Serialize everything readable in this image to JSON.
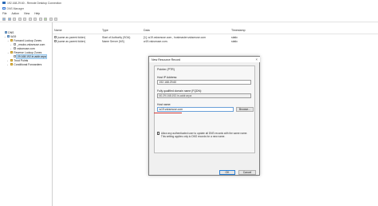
{
  "rdp": {
    "title": "192.168.29.60 - Remote Desktop Connection"
  },
  "app": {
    "title": "DNS Manager"
  },
  "menu": [
    "File",
    "Action",
    "View",
    "Help"
  ],
  "tree": [
    {
      "label": "DNS",
      "icon": "dns-icon",
      "arrow": "",
      "indent": 0
    },
    {
      "label": "W19",
      "icon": "server-icon",
      "arrow": "⌄",
      "indent": 1
    },
    {
      "label": "Forward Lookup Zones",
      "icon": "folder-icon",
      "arrow": "⌄",
      "indent": 2
    },
    {
      "label": "_msdcs.vsksmuse.com",
      "icon": "zone-icon",
      "arrow": "›",
      "indent": 3
    },
    {
      "label": "vsksmuse.com",
      "icon": "zone-icon",
      "arrow": "›",
      "indent": 3
    },
    {
      "label": "Reverse Lookup Zones",
      "icon": "folder-icon",
      "arrow": "⌄",
      "indent": 2
    },
    {
      "label": "29.168.192.in-addr.arpa",
      "icon": "zone-icon",
      "arrow": "",
      "indent": 3,
      "selected": true
    },
    {
      "label": "Trust Points",
      "icon": "folder-icon",
      "arrow": "›",
      "indent": 2
    },
    {
      "label": "Conditional Forwarders",
      "icon": "folder-icon",
      "arrow": "›",
      "indent": 2
    }
  ],
  "list": {
    "columns": [
      "Name",
      "Type",
      "Data",
      "Timestamp"
    ],
    "rows": [
      [
        "(same as parent folder)",
        "Start of Authority (SOA)",
        "[1], w19.vsksmuse.com., hostmaster.vsksmuse.com",
        "static"
      ],
      [
        "(same as parent folder)",
        "Name Server (NS)",
        "w19.vsksmuse.com.",
        "static"
      ]
    ]
  },
  "dialog": {
    "title": "New Resource Record",
    "close": "×",
    "group_title": "Pointer (PTR)",
    "host_ip_label": "Host IP Address:",
    "host_ip_value": "192.168.29.60",
    "fqdn_label": "Fully qualified domain name (FQDN):",
    "fqdn_value": "60.29.168.192.in-addr.arpa",
    "host_name_label": "Host name:",
    "host_name_value": "w19.vsksmuse.com",
    "browse_label": "Browse...",
    "checkbox_text": "Allow any authenticated user to update all DNS records with the same name. This setting applies only to DNS records for a new name.",
    "ok_label": "OK",
    "cancel_label": "Cancel"
  }
}
